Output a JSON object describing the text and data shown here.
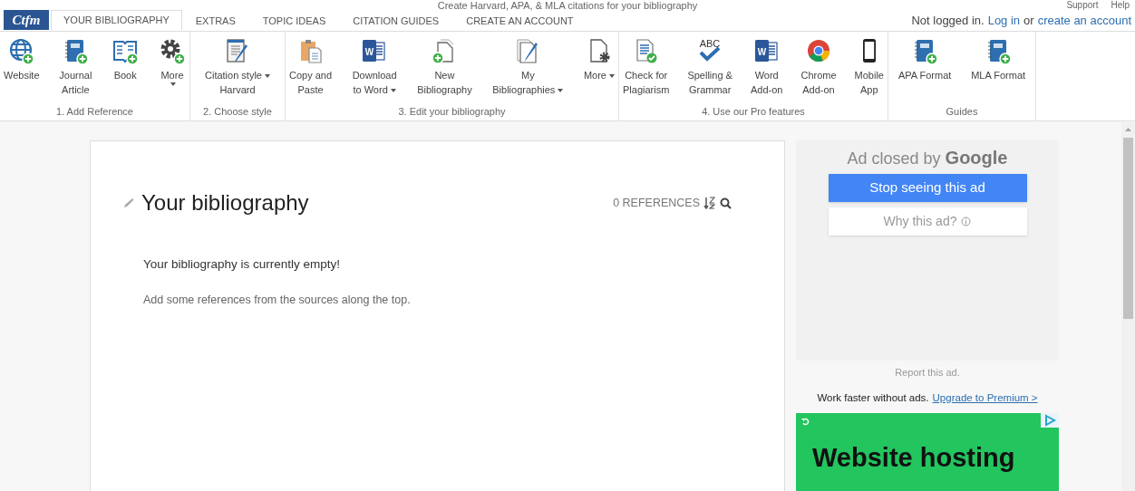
{
  "header": {
    "tagline": "Create Harvard, APA, & MLA citations for your bibliography",
    "support": "Support",
    "help": "Help"
  },
  "logo": "Ctfm",
  "tabs": [
    {
      "label": "YOUR BIBLIOGRAPHY",
      "selected": true
    },
    {
      "label": "EXTRAS",
      "selected": false
    },
    {
      "label": "TOPIC IDEAS",
      "selected": false
    },
    {
      "label": "CITATION GUIDES",
      "selected": false
    },
    {
      "label": "CREATE AN ACCOUNT",
      "selected": false
    }
  ],
  "account": {
    "status": "Not logged in.",
    "login": "Log in",
    "or": "or",
    "create": "create an account"
  },
  "toolbar": [
    {
      "title": "1. Add Reference",
      "items": [
        {
          "kind": "globe",
          "lines": [
            {
              "text": "Website",
              "dropdown": false
            }
          ],
          "dropdown_below": false
        },
        {
          "kind": "notebook",
          "lines": [
            {
              "text": "Journal",
              "dropdown": false
            },
            {
              "text": "Article",
              "dropdown": false
            }
          ],
          "dropdown_below": false
        },
        {
          "kind": "book",
          "lines": [
            {
              "text": "Book",
              "dropdown": false
            }
          ],
          "dropdown_below": false
        },
        {
          "kind": "gear",
          "lines": [
            {
              "text": "More",
              "dropdown": false
            }
          ],
          "dropdown_below": true
        }
      ]
    },
    {
      "title": "2. Choose style",
      "items": [
        {
          "kind": "docpen",
          "lines": [
            {
              "text": "Citation style",
              "dropdown": true
            },
            {
              "text": "Harvard",
              "dropdown": false
            }
          ],
          "dropdown_below": false
        }
      ]
    },
    {
      "title": "3. Edit your bibliography",
      "items": [
        {
          "kind": "clipboard",
          "lines": [
            {
              "text": "Copy and",
              "dropdown": false
            },
            {
              "text": "Paste",
              "dropdown": false
            }
          ],
          "dropdown_below": false
        },
        {
          "kind": "word",
          "icon_text": "W",
          "lines": [
            {
              "text": "Download",
              "dropdown": false
            },
            {
              "text": "to Word",
              "dropdown": true
            }
          ],
          "dropdown_below": false
        },
        {
          "kind": "newdoc",
          "lines": [
            {
              "text": "New",
              "dropdown": false
            },
            {
              "text": "Bibliography",
              "dropdown": false
            }
          ],
          "dropdown_below": false
        },
        {
          "kind": "docspen",
          "lines": [
            {
              "text": "My",
              "dropdown": false
            },
            {
              "text": "Bibliographies",
              "dropdown": true
            }
          ],
          "dropdown_below": false
        },
        {
          "kind": "docgear",
          "lines": [
            {
              "text": "More",
              "dropdown": true
            }
          ],
          "dropdown_below": false
        }
      ]
    },
    {
      "title": "4. Use our Pro features",
      "items": [
        {
          "kind": "plagiarism",
          "lines": [
            {
              "text": "Check for",
              "dropdown": false
            },
            {
              "text": "Plagiarism",
              "dropdown": false
            }
          ],
          "dropdown_below": false
        },
        {
          "kind": "abc",
          "icon_text": "ABC",
          "lines": [
            {
              "text": "Spelling &",
              "dropdown": false
            },
            {
              "text": "Grammar",
              "dropdown": false
            }
          ],
          "dropdown_below": false
        },
        {
          "kind": "word",
          "icon_text": "W",
          "lines": [
            {
              "text": "Word",
              "dropdown": false
            },
            {
              "text": "Add-on",
              "dropdown": false
            }
          ],
          "dropdown_below": false
        },
        {
          "kind": "chrome",
          "lines": [
            {
              "text": "Chrome",
              "dropdown": false
            },
            {
              "text": "Add-on",
              "dropdown": false
            }
          ],
          "dropdown_below": false
        },
        {
          "kind": "phone",
          "lines": [
            {
              "text": "Mobile",
              "dropdown": false
            },
            {
              "text": "App",
              "dropdown": false
            }
          ],
          "dropdown_below": false
        }
      ]
    },
    {
      "title": "Guides",
      "items": [
        {
          "kind": "notebook",
          "lines": [
            {
              "text": "APA Format",
              "dropdown": false
            }
          ],
          "dropdown_below": false
        },
        {
          "kind": "notebook",
          "lines": [
            {
              "text": "MLA Format",
              "dropdown": false
            }
          ],
          "dropdown_below": false
        }
      ]
    }
  ],
  "bibliography": {
    "title": "Your bibliography",
    "count": "0 REFERENCES",
    "empty": "Your bibliography is currently empty!",
    "hint": "Add some references from the sources along the top."
  },
  "ad": {
    "closed_by": "Ad closed by",
    "brand": "Google",
    "stop": "Stop seeing this ad",
    "why": "Why this ad?",
    "report": "Report this ad.",
    "upsell": "Work faster without ads.",
    "upgrade": "Upgrade to Premium >",
    "banner": "Website hosting"
  }
}
